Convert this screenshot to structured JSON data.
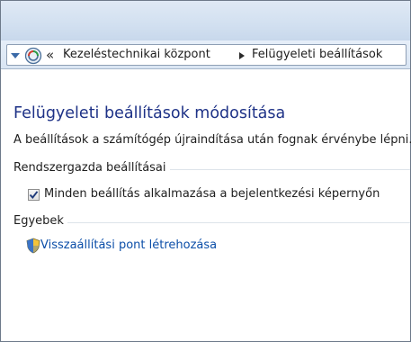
{
  "address_bar": {
    "chevrons": "«",
    "breadcrumbs": [
      "Kezeléstechnikai központ",
      "Felügyeleti beállítások"
    ]
  },
  "main": {
    "title": "Felügyeleti beállítások módosítása",
    "subtitle": "A beállítások a számítógép újraindítása után fognak érvénybe lépni.",
    "groups": [
      {
        "label": "Rendszergazda beállításai",
        "checkbox": {
          "label": "Minden beállítás alkalmazása a bejelentkezési képernyőn",
          "checked": true
        }
      },
      {
        "label": "Egyebek",
        "link": {
          "label": "Visszaállítási pont létrehozása",
          "icon": "shield-icon"
        }
      }
    ]
  },
  "colors": {
    "title": "#1e3287",
    "link": "#0b4ea8",
    "chrome": "#d9e5f3"
  }
}
